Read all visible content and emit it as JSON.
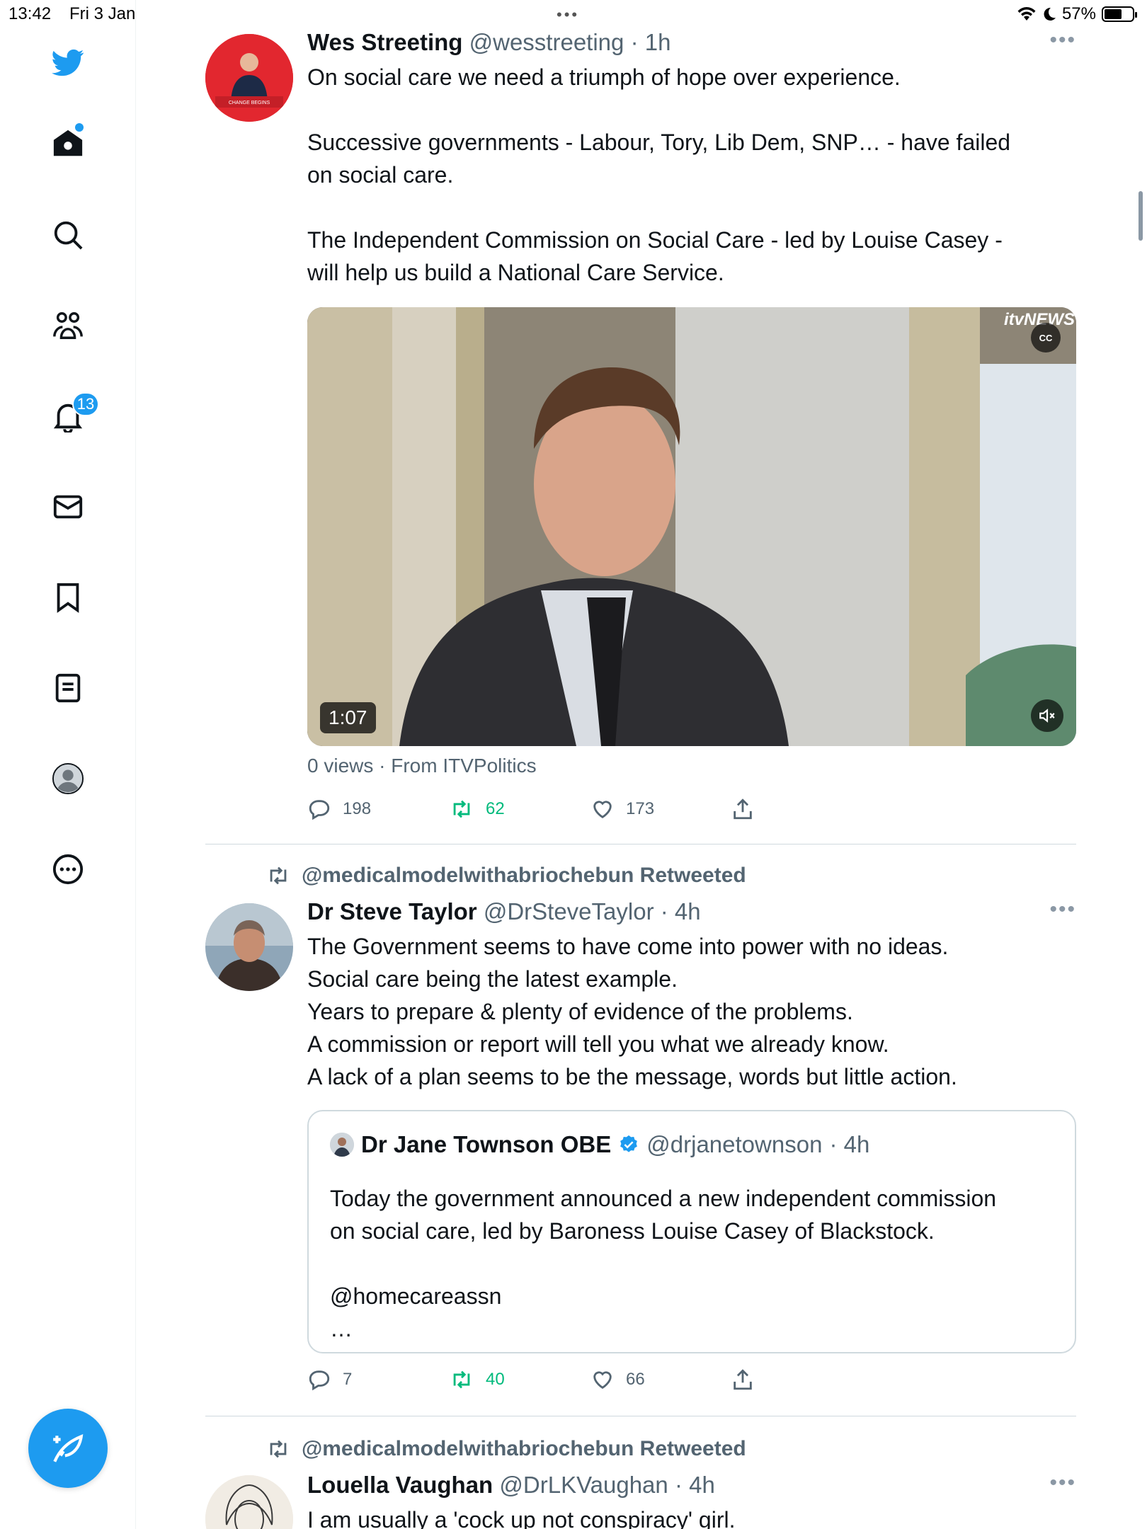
{
  "status_bar": {
    "time": "13:42",
    "date": "Fri 3 Jan",
    "battery": "57%"
  },
  "sidebar": {
    "notifications_badge": "13",
    "items": [
      "Home",
      "Explore",
      "Communities",
      "Notifications",
      "Messages",
      "Bookmarks",
      "Lists",
      "Profile",
      "More"
    ]
  },
  "tweets": [
    {
      "name": "Wes Streeting",
      "handle": "@wesstreeting",
      "time": "· 1h",
      "text": "On social care we need a triumph of hope over experience.\n\nSuccessive governments - Labour, Tory, Lib Dem, SNP… - have failed\non social care.\n\nThe Independent Commission on Social Care - led by Louise Casey -\nwill help us build a National Care Service.",
      "video": {
        "duration": "1:07",
        "logo": "itvNEWS",
        "cc": "CC"
      },
      "meta": "0 views · From ITVPolitics",
      "replies": "198",
      "retweets": "62",
      "likes": "173"
    },
    {
      "retweeted_by": "@medicalmodelwithabriochebun Retweeted",
      "name": "Dr Steve Taylor",
      "handle": "@DrSteveTaylor",
      "time": "· 4h",
      "text": "The Government seems to have come into power with no ideas.\nSocial care being the latest example.\nYears to prepare & plenty of evidence of the problems.\nA commission or report will tell you what we already know.\nA lack of a plan seems to be the message, words but little action.",
      "quote": {
        "name": "Dr Jane Townson OBE",
        "handle": "@drjanetownson",
        "time": "· 4h",
        "text": "Today the government announced a new independent commission\non social care, led by Baroness Louise Casey of Blackstock.\n\n@homecareassn\n…"
      },
      "replies": "7",
      "retweets": "40",
      "likes": "66"
    },
    {
      "retweeted_by": "@medicalmodelwithabriochebun Retweeted",
      "name": "Louella Vaughan",
      "handle": "@DrLKVaughan",
      "time": "· 4h",
      "text": "I am usually a 'cock up not conspiracy' girl."
    }
  ],
  "colors": {
    "accent": "#1d9bf0",
    "retweet": "#00ba7c",
    "muted": "#536471"
  }
}
